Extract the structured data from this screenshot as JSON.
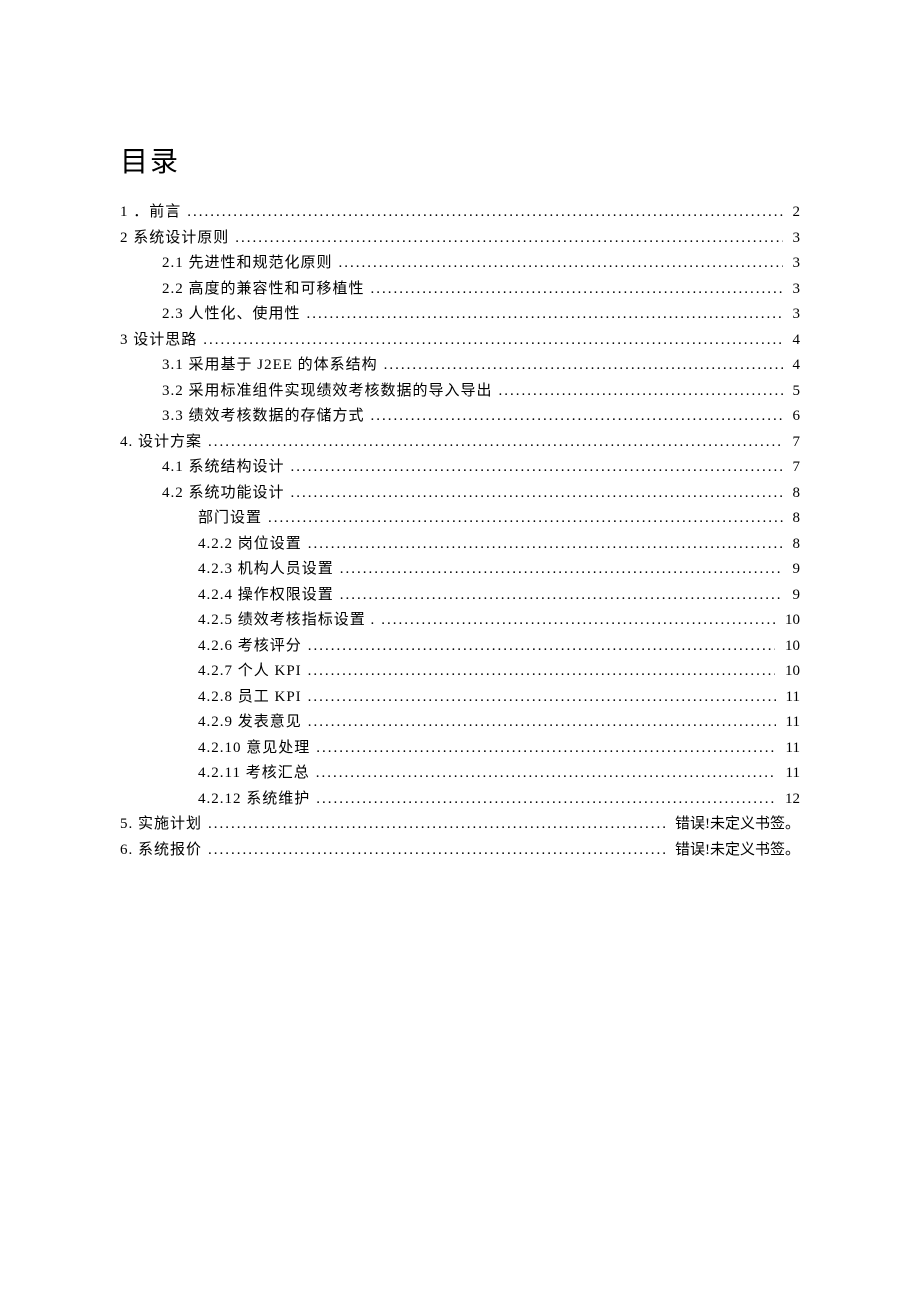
{
  "title": "目录",
  "toc": [
    {
      "indent": 0,
      "label": "1  ．前言",
      "page": "2"
    },
    {
      "indent": 0,
      "label": "2  系统设计原则",
      "page": "3"
    },
    {
      "indent": 1,
      "label": "2.1 先进性和规范化原则",
      "page": "3"
    },
    {
      "indent": 1,
      "label": "2.2 高度的兼容性和可移植性",
      "page": "3"
    },
    {
      "indent": 1,
      "label": "2.3 人性化、使用性",
      "page": "3"
    },
    {
      "indent": 0,
      "label": "3  设计思路",
      "page": "4"
    },
    {
      "indent": 1,
      "label": "3.1 采用基于 J2EE 的体系结构",
      "page": "4"
    },
    {
      "indent": 1,
      "label": "3.2 采用标准组件实现绩效考核数据的导入导出",
      "page": "5"
    },
    {
      "indent": 1,
      "label": "3.3 绩效考核数据的存储方式",
      "page": "6"
    },
    {
      "indent": 0,
      "label": "4.  设计方案",
      "page": "7"
    },
    {
      "indent": 1,
      "label": "4.1  系统结构设计",
      "page": "7"
    },
    {
      "indent": 1,
      "label": "4.2 系统功能设计",
      "page": "8"
    },
    {
      "indent": 2,
      "label": "部门设置",
      "page": "8"
    },
    {
      "indent": 2,
      "label": "4.2.2 岗位设置",
      "page": "8"
    },
    {
      "indent": 2,
      "label": "4.2.3 机构人员设置",
      "page": "9"
    },
    {
      "indent": 2,
      "label": "4.2.4 操作权限设置",
      "page": "9"
    },
    {
      "indent": 2,
      "label": "4.2.5 绩效考核指标设置 .",
      "page": "10"
    },
    {
      "indent": 2,
      "label": "4.2.6 考核评分",
      "page": "10"
    },
    {
      "indent": 2,
      "label": "4.2.7 个人 KPI",
      "page": "10"
    },
    {
      "indent": 2,
      "label": "4.2.8 员工 KPI",
      "page": "11"
    },
    {
      "indent": 2,
      "label": "4.2.9 发表意见",
      "page": "11"
    },
    {
      "indent": 2,
      "label": "4.2.10 意见处理",
      "page": "11"
    },
    {
      "indent": 2,
      "label": "4.2.11 考核汇总",
      "page": "11"
    },
    {
      "indent": 2,
      "label": "4.2.12 系统维护",
      "page": "12"
    },
    {
      "indent": 0,
      "label": "5.  实施计划",
      "page": "错误!未定义书签。"
    },
    {
      "indent": 0,
      "label": "6.  系统报价",
      "page": "错误!未定义书签。"
    }
  ]
}
